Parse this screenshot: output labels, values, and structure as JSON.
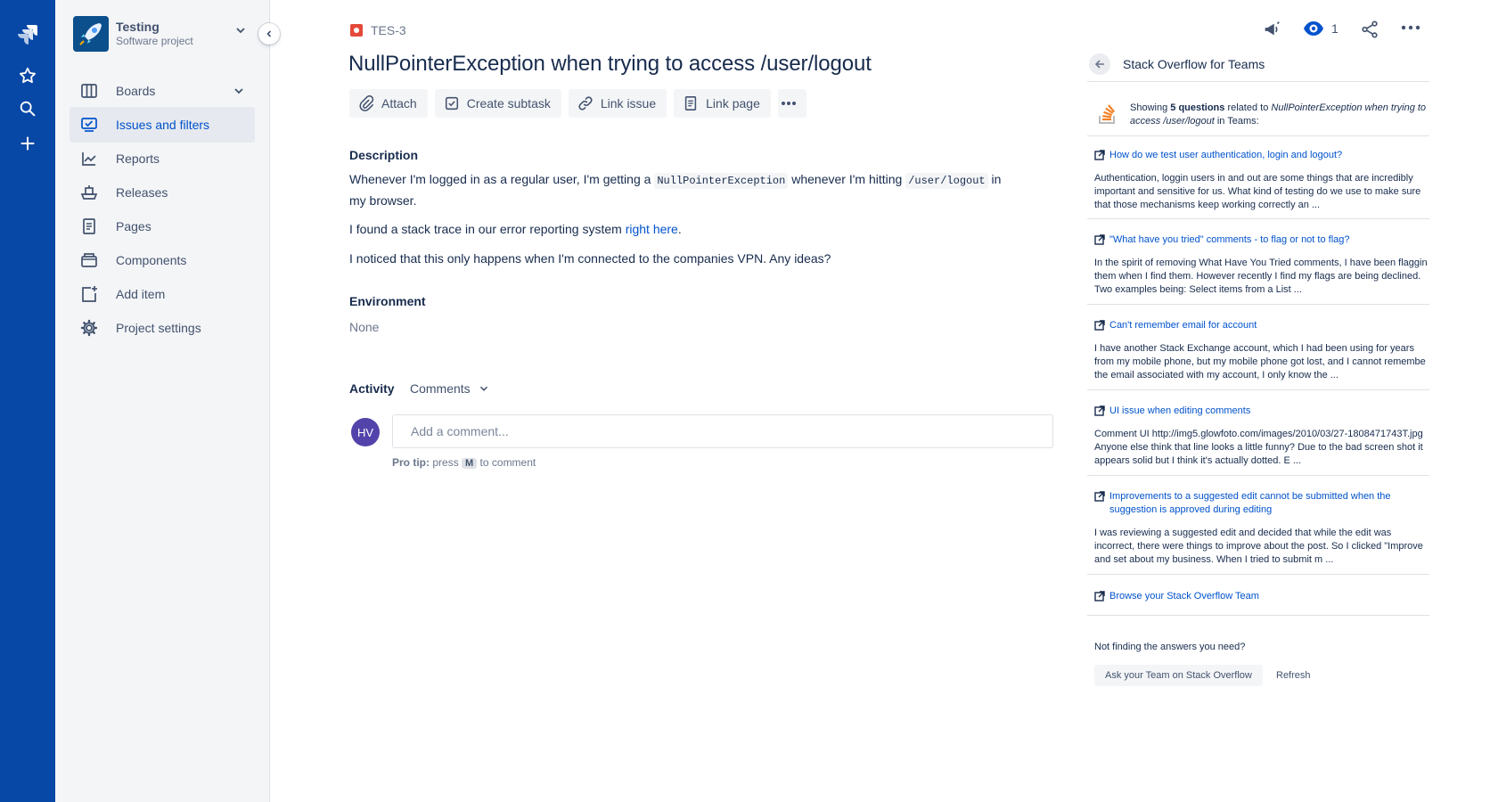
{
  "colors": {
    "global_nav": "#0747A6",
    "link": "#0052CC",
    "bug_red": "#E5493A",
    "avatar_purple": "#5243AA"
  },
  "project": {
    "name": "Testing",
    "type": "Software project"
  },
  "sidebar": {
    "items": [
      {
        "label": "Boards",
        "icon": "board-icon"
      },
      {
        "label": "Issues and filters",
        "icon": "issues-icon"
      },
      {
        "label": "Reports",
        "icon": "reports-icon"
      },
      {
        "label": "Releases",
        "icon": "releases-icon"
      },
      {
        "label": "Pages",
        "icon": "page-icon"
      },
      {
        "label": "Components",
        "icon": "components-icon"
      },
      {
        "label": "Add item",
        "icon": "add-item-icon"
      },
      {
        "label": "Project settings",
        "icon": "gear-icon"
      }
    ]
  },
  "issue": {
    "key": "TES-3",
    "title": "NullPointerException when trying to access /user/logout",
    "toolbar": {
      "attach": "Attach",
      "create_subtask": "Create subtask",
      "link_issue": "Link issue",
      "link_page": "Link page"
    },
    "description_heading": "Description",
    "desc_p1_a": "Whenever I'm logged in as a regular user, I'm getting a",
    "desc_p1_code1": "NullPointerException",
    "desc_p1_b": "whenever I'm hitting",
    "desc_p1_code2": "/user/logout",
    "desc_p1_c": "in my browser.",
    "desc_p2_a": "I found a stack trace in our error reporting system",
    "desc_p2_link": "right here",
    "desc_p2_b": ".",
    "desc_p3": "I noticed that this only happens when I'm connected to the companies VPN. Any ideas?",
    "environment_heading": "Environment",
    "environment_value": "None",
    "activity_heading": "Activity",
    "activity_filter": "Comments",
    "avatar_initials": "HV",
    "comment_placeholder": "Add a comment...",
    "pro_tip_label": "Pro tip:",
    "pro_tip_press": "press",
    "pro_tip_key": "M",
    "pro_tip_suffix": "to comment",
    "watchers": "1"
  },
  "so_panel": {
    "title": "Stack Overflow for Teams",
    "showing_prefix": "Showing",
    "showing_count": "5 questions",
    "showing_mid": "related to",
    "showing_query": "NullPointerException when trying to access /user/logout",
    "showing_suffix": "in Teams:",
    "questions": [
      {
        "title": "How do we test user authentication, login and logout?",
        "excerpt": [
          "Authentication, loggin users in and out are some things that are incredibly",
          "important and sensitive for us. What kind of testing do we use to make sure",
          "that those mechanisms keep working correctly an ..."
        ]
      },
      {
        "title": "\"What have you tried\" comments - to flag or not to flag?",
        "excerpt": [
          "In the spirit of removing What Have You Tried comments, I have been flaggin",
          "them when I find them. However recently I find my flags are being declined.",
          "Two examples being: Select items from a List ..."
        ]
      },
      {
        "title": "Can't remember email for account",
        "excerpt": [
          "I have another Stack Exchange account, which I had been using for years",
          "from my mobile phone, but my mobile phone got lost, and I cannot remembe",
          "the email associated with my account, I only know the ..."
        ]
      },
      {
        "title": "UI issue when editing comments",
        "excerpt": [
          "Comment UI http://img5.glowfoto.com/images/2010/03/27-1808471743T.jpg",
          "Anyone else think that line looks a little funny? Due to the bad screen shot it",
          "appears solid but I think it's actually dotted. E ..."
        ]
      },
      {
        "title": "Improvements to a suggested edit cannot be submitted when the suggestion is approved during editing",
        "excerpt": [
          "I was reviewing a suggested edit and decided that while the edit was",
          "incorrect, there were things to improve about the post. So I clicked \"Improve",
          "and set about my business. When I tried to submit m ..."
        ]
      }
    ],
    "browse_link": "Browse your Stack Overflow Team",
    "footer_text": "Not finding the answers you need?",
    "ask_button": "Ask your Team on Stack Overflow",
    "refresh_button": "Refresh"
  }
}
